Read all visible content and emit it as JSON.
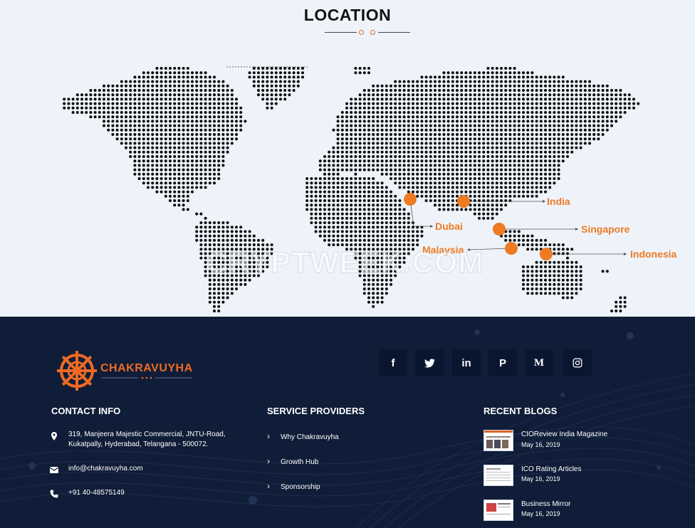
{
  "location": {
    "title": "LOCATION",
    "markers": [
      {
        "name": "Dubai",
        "label": "Dubai",
        "color": "#ef7a22"
      },
      {
        "name": "India",
        "label": "India",
        "color": "#ef7a22"
      },
      {
        "name": "Singapore",
        "label": "Singapore",
        "color": "#ef7a22"
      },
      {
        "name": "Malaysia",
        "label": "Malaysia",
        "color": "#ef7a22"
      },
      {
        "name": "Indonesia",
        "label": "Indonesia",
        "color": "#ef7a22"
      }
    ]
  },
  "footer": {
    "brand": "CHAKRAVUYHA",
    "social": [
      {
        "icon": "facebook-icon",
        "glyph": "f"
      },
      {
        "icon": "twitter-icon",
        "glyph": "🐦"
      },
      {
        "icon": "linkedin-icon",
        "glyph": "in"
      },
      {
        "icon": "pinterest-icon",
        "glyph": "P"
      },
      {
        "icon": "medium-icon",
        "glyph": "M"
      },
      {
        "icon": "instagram-icon",
        "glyph": "◎"
      }
    ],
    "contact": {
      "title": "CONTACT INFO",
      "address_line1": "319, Manjeera Majestic Commercial, JNTU-Road,",
      "address_line2": "Kukatpally, Hyderabad, Telangana - 500072.",
      "email": "info@chakravuyha.com",
      "phone": "+91 40-48575149"
    },
    "services": {
      "title": "SERVICE PROVIDERS",
      "links": [
        "Why Chakravuyha",
        "Growth Hub",
        "Sponsorship"
      ]
    },
    "blogs": {
      "title": "RECENT BLOGS",
      "items": [
        {
          "title": "CIOReview India Magazine",
          "date": "May 16, 2019"
        },
        {
          "title": "ICO Rating Articles",
          "date": "May 16, 2019"
        },
        {
          "title": "Business Mirror",
          "date": "May 16, 2019"
        }
      ]
    },
    "accent_color": "#ef6a24",
    "background_color": "#0f1d38"
  }
}
